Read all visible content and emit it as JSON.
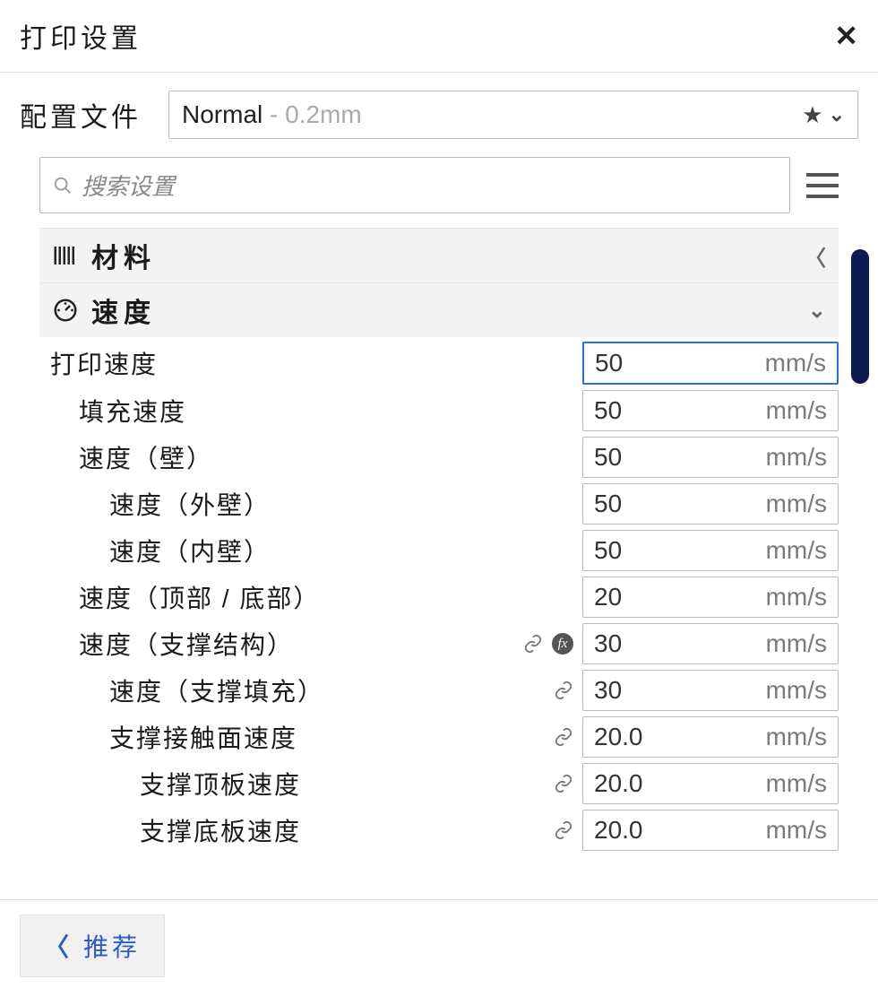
{
  "header": {
    "title": "打印设置"
  },
  "profile": {
    "label": "配置文件",
    "name": "Normal",
    "separator": " - ",
    "detail": "0.2mm"
  },
  "search": {
    "placeholder": "搜索设置"
  },
  "sections": [
    {
      "id": "material",
      "title": "材料",
      "icon": "material-icon",
      "expanded": false
    },
    {
      "id": "speed",
      "title": "速度",
      "icon": "gauge-icon",
      "expanded": true
    }
  ],
  "speed": {
    "unit": "mm/s",
    "rows": [
      {
        "id": "print_speed",
        "label": "打印速度",
        "value": "50",
        "indent": 0,
        "selected": true,
        "link": false,
        "fx": false
      },
      {
        "id": "infill_speed",
        "label": "填充速度",
        "value": "50",
        "indent": 1,
        "link": false,
        "fx": false
      },
      {
        "id": "wall_speed",
        "label": "速度（壁）",
        "value": "50",
        "indent": 1,
        "link": false,
        "fx": false
      },
      {
        "id": "outer_wall_speed",
        "label": "速度（外壁）",
        "value": "50",
        "indent": 2,
        "link": false,
        "fx": false
      },
      {
        "id": "inner_wall_speed",
        "label": "速度（内壁）",
        "value": "50",
        "indent": 2,
        "link": false,
        "fx": false
      },
      {
        "id": "top_bottom_speed",
        "label": "速度（顶部 / 底部）",
        "value": "20",
        "indent": 1,
        "link": false,
        "fx": false
      },
      {
        "id": "support_speed",
        "label": "速度（支撑结构）",
        "value": "30",
        "indent": 1,
        "link": true,
        "fx": true
      },
      {
        "id": "support_infill_speed",
        "label": "速度（支撑填充）",
        "value": "30",
        "indent": 2,
        "link": true,
        "fx": false
      },
      {
        "id": "support_interface_speed",
        "label": "支撑接触面速度",
        "value": "20.0",
        "indent": 2,
        "link": true,
        "fx": false
      },
      {
        "id": "support_roof_speed",
        "label": "支撑顶板速度",
        "value": "20.0",
        "indent": 3,
        "link": true,
        "fx": false
      },
      {
        "id": "support_floor_speed",
        "label": "支撑底板速度",
        "value": "20.0",
        "indent": 3,
        "link": true,
        "fx": false
      }
    ]
  },
  "footer": {
    "recommend": "推荐"
  }
}
